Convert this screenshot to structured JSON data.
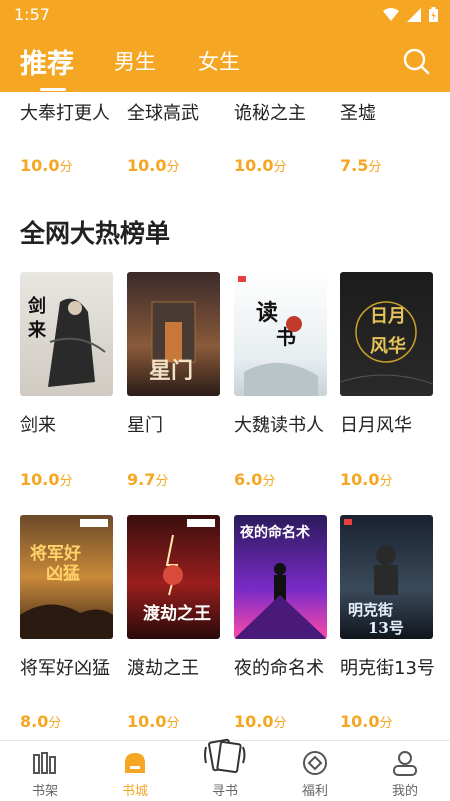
{
  "status_bar": {
    "time": "1:57"
  },
  "header": {
    "tabs": [
      "推荐",
      "男生",
      "女生"
    ]
  },
  "top_row": [
    {
      "title": "大奉打更人",
      "score": "10.0",
      "unit": "分"
    },
    {
      "title": "全球高武",
      "score": "10.0",
      "unit": "分"
    },
    {
      "title": "诡秘之主",
      "score": "10.0",
      "unit": "分"
    },
    {
      "title": "圣墟",
      "score": "7.5",
      "unit": "分"
    }
  ],
  "section": {
    "title": "全网大热榜单"
  },
  "books_row1": [
    {
      "title": "剑来",
      "score": "10.0",
      "unit": "分",
      "cover_text": "剑来"
    },
    {
      "title": "星门",
      "score": "9.7",
      "unit": "分",
      "cover_text": "星门"
    },
    {
      "title": "大魏读书人",
      "score": "6.0",
      "unit": "分",
      "cover_text": "读书人"
    },
    {
      "title": "日月风华",
      "score": "10.0",
      "unit": "分",
      "cover_text": "日月风华"
    }
  ],
  "books_row2": [
    {
      "title": "将军好凶猛",
      "score": "8.0",
      "unit": "分",
      "cover_text": "将军好凶猛"
    },
    {
      "title": "渡劫之王",
      "score": "10.0",
      "unit": "分",
      "cover_text": "渡劫之王"
    },
    {
      "title": "夜的命名术",
      "score": "10.0",
      "unit": "分",
      "cover_text": "夜的命名术"
    },
    {
      "title": "明克街13号",
      "score": "10.0",
      "unit": "分",
      "cover_text": "明克街13号"
    }
  ],
  "tabbar": [
    {
      "label": "书架",
      "icon": "bookshelf-icon"
    },
    {
      "label": "书城",
      "icon": "bookstore-icon"
    },
    {
      "label": "寻书",
      "icon": "find-book-icon"
    },
    {
      "label": "福利",
      "icon": "welfare-icon"
    },
    {
      "label": "我的",
      "icon": "profile-icon"
    }
  ],
  "colors": {
    "accent": "#F5A623"
  }
}
